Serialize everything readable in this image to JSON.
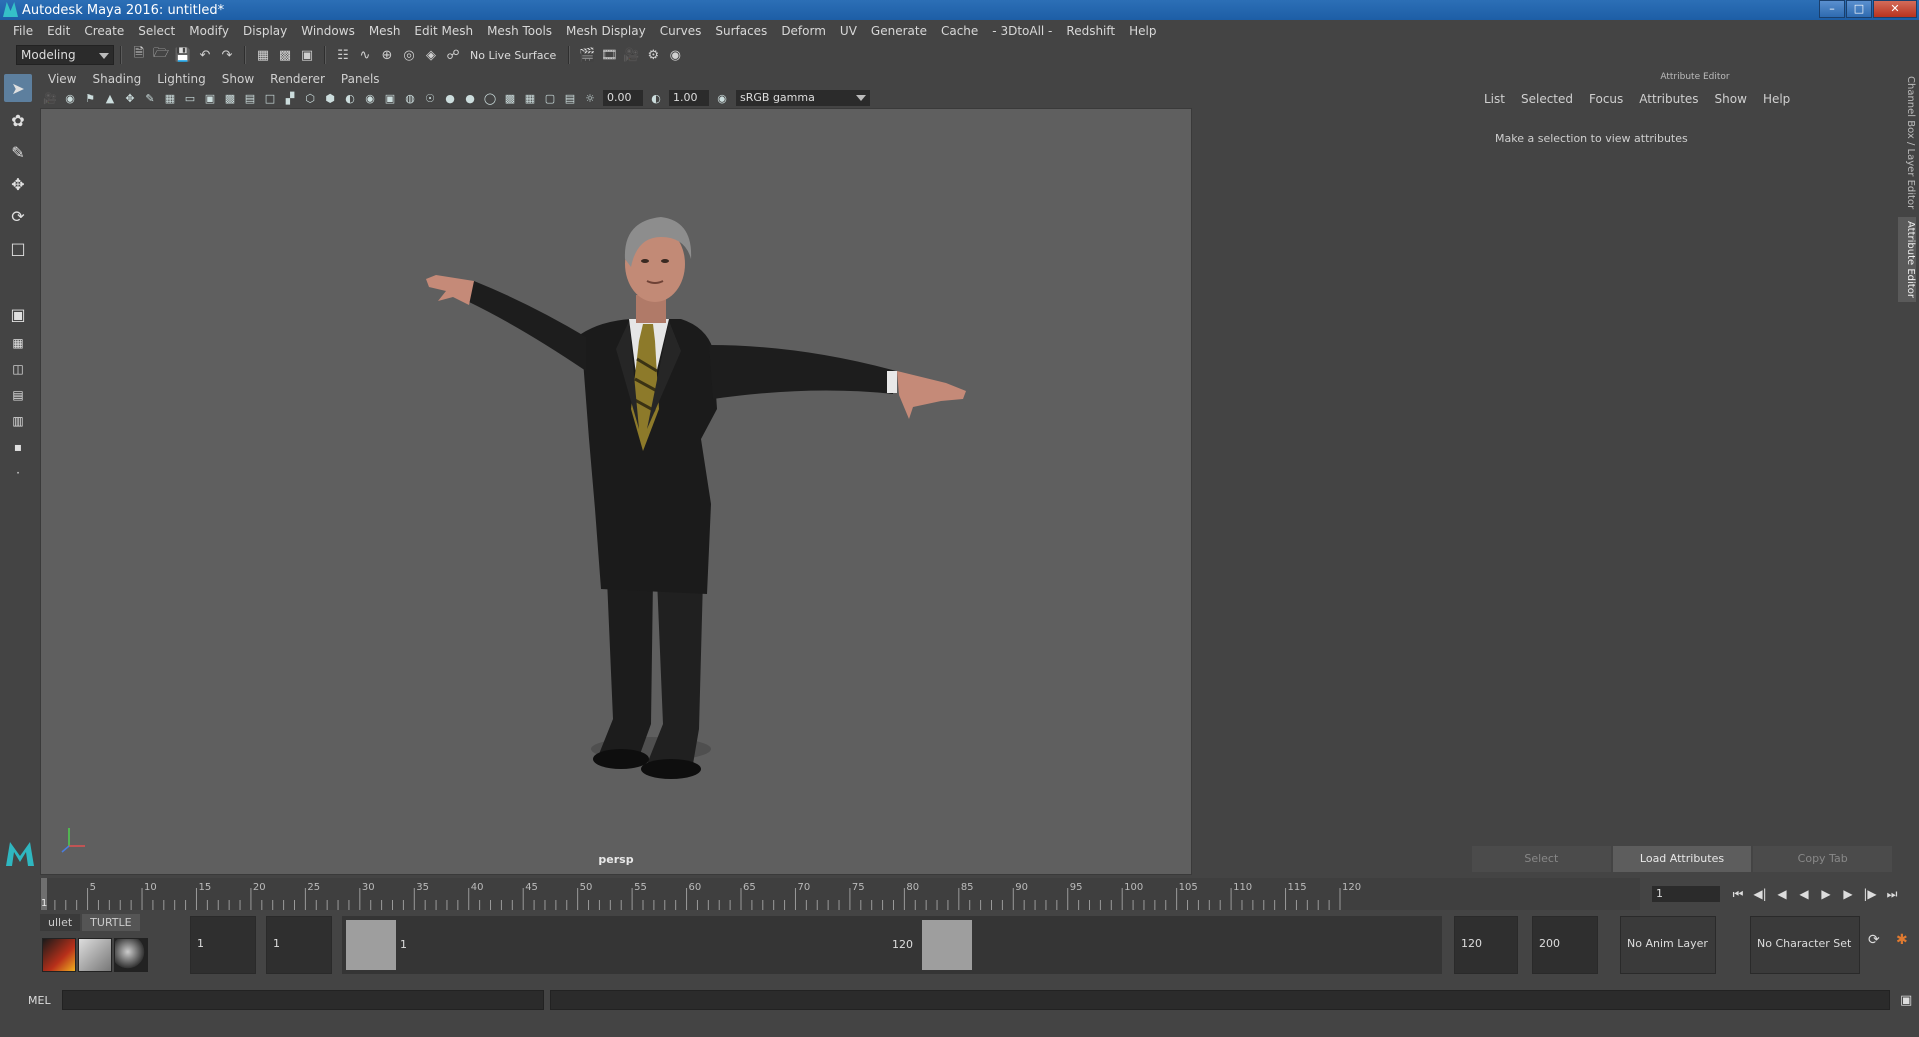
{
  "window": {
    "title": "Autodesk Maya 2016: untitled*"
  },
  "menubar": {
    "items": [
      "File",
      "Edit",
      "Create",
      "Select",
      "Modify",
      "Display",
      "Windows",
      "Mesh",
      "Edit Mesh",
      "Mesh Tools",
      "Mesh Display",
      "Curves",
      "Surfaces",
      "Deform",
      "UV",
      "Generate",
      "Cache",
      "- 3DtoAll -",
      "Redshift",
      "Help"
    ]
  },
  "statusline": {
    "mode": "Modeling",
    "live_surface": "No Live Surface"
  },
  "viewport": {
    "menu": [
      "View",
      "Shading",
      "Lighting",
      "Show",
      "Renderer",
      "Panels"
    ],
    "exposure": "0.00",
    "gamma_value": "1.00",
    "color_space": "sRGB gamma",
    "camera": "persp",
    "background": "#5f5f5f"
  },
  "attribute_editor": {
    "title": "Attribute Editor",
    "menu": [
      "List",
      "Selected",
      "Focus",
      "Attributes",
      "Show",
      "Help"
    ],
    "message": "Make a selection to view attributes",
    "buttons": {
      "select": "Select",
      "load": "Load Attributes",
      "copy": "Copy Tab"
    },
    "side_tabs": [
      "Channel Box / Layer Editor",
      "Attribute Editor"
    ]
  },
  "timeline": {
    "ticks": [
      5,
      10,
      15,
      20,
      25,
      30,
      35,
      40,
      45,
      50,
      55,
      60,
      65,
      70,
      75,
      80,
      85,
      90,
      95,
      100,
      105,
      110,
      115,
      120
    ],
    "start_label": "1",
    "current_frame": "1"
  },
  "shelf": {
    "tabs": [
      "ullet",
      "TURTLE"
    ]
  },
  "range": {
    "start": "1",
    "playback_start": "1",
    "slider_start": "1",
    "slider_end": "120",
    "playback_end": "120",
    "end": "200",
    "anim_layer": "No Anim Layer",
    "character_set": "No Character Set"
  },
  "mel": {
    "label": "MEL"
  }
}
